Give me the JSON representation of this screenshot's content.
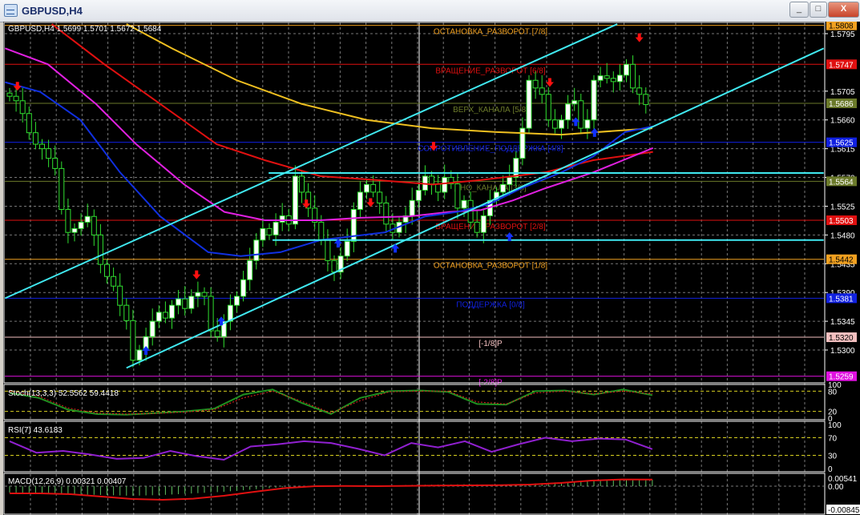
{
  "window": {
    "title": "GBPUSD,H4",
    "minimize_label": "_",
    "restore_label": "□",
    "close_label": "X"
  },
  "main": {
    "header": "GBPUSD,H4  1.5699 1.5701 1.5672 1.5684",
    "price_ticks": [
      "1.5795",
      "1.5705",
      "1.5660",
      "1.5615",
      "1.5570",
      "1.5525",
      "1.5480",
      "1.5435",
      "1.5390",
      "1.5345",
      "1.5300"
    ],
    "levels": [
      {
        "price": 1.5808,
        "label": "ОСТАНОВКА_РАЗВОРОТ [7/8]",
        "tag": "1.5808",
        "color": "#f0a020",
        "tagtext": "#000000"
      },
      {
        "price": 1.5747,
        "label": "ВРАЩЕНИЕ_РАЗВОРОТ [6/8]",
        "tag": "1.5747",
        "color": "#e01010",
        "tagtext": "#ffffff"
      },
      {
        "price": 1.5686,
        "label": "ВЕРХ_КАНАЛА [5/8]",
        "tag": "1.5686",
        "color": "#6b7a2a",
        "tagtext": "#ffffff"
      },
      {
        "price": 1.5625,
        "label": "СОПРОТИВЛЕНИЕ_ПОДДЕРЖКА [4/8]",
        "tag": "1.5625",
        "color": "#1020e0",
        "tagtext": "#ffffff"
      },
      {
        "price": 1.5564,
        "label": "ДНО_КАНАЛА [3/8]",
        "tag": "1.5564",
        "color": "#6b7a2a",
        "tagtext": "#ffffff"
      },
      {
        "price": 1.5503,
        "label": "ВРАЩЕНИЕ_РАЗВОРОТ [2/8]",
        "tag": "1.5503",
        "color": "#e01010",
        "tagtext": "#ffffff"
      },
      {
        "price": 1.5442,
        "label": "ОСТАНОВКА_РАЗВОРОТ [1/8]",
        "tag": "1.5442",
        "color": "#f0a020",
        "tagtext": "#000000"
      },
      {
        "price": 1.5381,
        "label": "ПОДДЕРЖКА [0/8]",
        "tag": "1.5381",
        "color": "#1020e0",
        "tagtext": "#ffffff"
      },
      {
        "price": 1.532,
        "label": "[-1/8]P",
        "tag": "1.5320",
        "color": "#f4c0c0",
        "tagtext": "#000000"
      },
      {
        "price": 1.5259,
        "label": "[-2/8]P",
        "tag": "1.5259",
        "color": "#e010e0",
        "tagtext": "#ffffff"
      }
    ],
    "closes": [
      1.5697,
      1.569,
      1.567,
      1.564,
      1.5622,
      1.5615,
      1.56,
      1.5584,
      1.552,
      1.5484,
      1.549,
      1.55,
      1.5509,
      1.548,
      1.5434,
      1.5415,
      1.54,
      1.537,
      1.5346,
      1.5284,
      1.53,
      1.5321,
      1.5345,
      1.5359,
      1.535,
      1.537,
      1.538,
      1.5365,
      1.5384,
      1.539,
      1.5384,
      1.533,
      1.5321,
      1.5345,
      1.537,
      1.5384,
      1.541,
      1.544,
      1.5472,
      1.549,
      1.548,
      1.55,
      1.551,
      1.5497,
      1.5572,
      1.5547,
      1.5522,
      1.55,
      1.5472,
      1.544,
      1.5422,
      1.5447,
      1.547,
      1.552,
      1.5547,
      1.5559,
      1.5547,
      1.553,
      1.5497,
      1.5484,
      1.55,
      1.551,
      1.5534,
      1.555,
      1.5572,
      1.556,
      1.5547,
      1.557,
      1.556,
      1.5522,
      1.5534,
      1.55,
      1.5484,
      1.551,
      1.5534,
      1.5547,
      1.5559,
      1.557,
      1.56,
      1.5647,
      1.5722,
      1.571,
      1.57,
      1.566,
      1.5647,
      1.566,
      1.5685,
      1.569,
      1.5647,
      1.566,
      1.5722,
      1.5729,
      1.5725,
      1.572,
      1.573,
      1.5747,
      1.571,
      1.57,
      1.5684
    ],
    "moving_averages": [
      {
        "name": "yellow-ma",
        "color": "#f0c020",
        "points": [
          [
            18,
            1.581
          ],
          [
            25,
            1.5772
          ],
          [
            35,
            1.5722
          ],
          [
            45,
            1.5685
          ],
          [
            55,
            1.566
          ],
          [
            65,
            1.5647
          ],
          [
            75,
            1.5641
          ],
          [
            85,
            1.5637
          ],
          [
            99,
            1.5647
          ]
        ]
      },
      {
        "name": "red-ma",
        "color": "#e01010",
        "points": [
          [
            6.5,
            1.581
          ],
          [
            14.6,
            1.5747
          ],
          [
            23.2,
            1.5685
          ],
          [
            31.9,
            1.5622
          ],
          [
            39.3,
            1.5597
          ],
          [
            47.9,
            1.5572
          ],
          [
            56.5,
            1.5566
          ],
          [
            65.2,
            1.5559
          ],
          [
            72.6,
            1.5566
          ],
          [
            82.5,
            1.5578
          ],
          [
            89.9,
            1.5597
          ],
          [
            99.1,
            1.561
          ]
        ]
      },
      {
        "name": "magenta-ma",
        "color": "#e020e0",
        "points": [
          [
            -0.7,
            1.5772
          ],
          [
            5.9,
            1.5747
          ],
          [
            13.3,
            1.5685
          ],
          [
            19.5,
            1.5622
          ],
          [
            26.9,
            1.5559
          ],
          [
            33.1,
            1.5516
          ],
          [
            39.3,
            1.5503
          ],
          [
            47.9,
            1.5503
          ],
          [
            54.1,
            1.5507
          ],
          [
            61.5,
            1.5509
          ],
          [
            67.7,
            1.5516
          ],
          [
            72.6,
            1.5519
          ],
          [
            77.5,
            1.5534
          ],
          [
            82.5,
            1.5553
          ],
          [
            89.9,
            1.5578
          ],
          [
            99.1,
            1.5616
          ]
        ]
      },
      {
        "name": "blue-ma",
        "color": "#1030e0",
        "points": [
          [
            -0.7,
            1.5719
          ],
          [
            4.7,
            1.5704
          ],
          [
            10.9,
            1.566
          ],
          [
            17,
            1.5578
          ],
          [
            23.2,
            1.5509
          ],
          [
            30.6,
            1.5453
          ],
          [
            35.6,
            1.5447
          ],
          [
            41.7,
            1.5453
          ],
          [
            47.9,
            1.5472
          ],
          [
            57.8,
            1.5484
          ],
          [
            64,
            1.5509
          ],
          [
            68.9,
            1.5516
          ],
          [
            73.8,
            1.5528
          ],
          [
            78.8,
            1.5553
          ],
          [
            85,
            1.5578
          ],
          [
            89.9,
            1.5603
          ],
          [
            94.8,
            1.5641
          ],
          [
            99.1,
            1.565
          ]
        ]
      }
    ],
    "trendlines": [
      {
        "from": [
          -0.7,
          1.5381
        ],
        "to": [
          93.6,
          1.581
        ]
      },
      {
        "from": [
          18,
          1.5272
        ],
        "to": [
          125.4,
          1.5772
        ]
      },
      {
        "from": [
          39.9,
          1.5577
        ],
        "to": [
          125.4,
          1.5577
        ]
      },
      {
        "from": [
          40.5,
          1.5472
        ],
        "to": [
          125.4,
          1.5472
        ]
      }
    ],
    "sell_arrows": [
      [
        1.2,
        1.5712
      ],
      [
        28.8,
        1.5417
      ],
      [
        45.7,
        1.5528
      ],
      [
        55.6,
        1.553
      ],
      [
        65.3,
        1.5618
      ],
      [
        83.2,
        1.5718
      ],
      [
        97,
        1.5788
      ]
    ],
    "buy_arrows": [
      [
        21,
        1.53
      ],
      [
        32.6,
        1.5346
      ],
      [
        50.6,
        1.5468
      ],
      [
        59.4,
        1.546
      ],
      [
        77,
        1.5478
      ],
      [
        87.2,
        1.5658
      ],
      [
        90.1,
        1.5641
      ]
    ]
  },
  "stoch": {
    "header": "Stoch(13,3,3) 52.5562 59.4418",
    "ticks": [
      "100",
      "80",
      "20",
      "0"
    ],
    "main": [
      75,
      60,
      25,
      12,
      10,
      15,
      20,
      28,
      70,
      85,
      45,
      12,
      60,
      80,
      82,
      78,
      42,
      40,
      80,
      82,
      70,
      85,
      68
    ],
    "signal": [
      80,
      65,
      30,
      15,
      12,
      14,
      18,
      25,
      60,
      80,
      50,
      15,
      52,
      78,
      80,
      80,
      48,
      42,
      75,
      80,
      72,
      80,
      72
    ]
  },
  "rsi": {
    "header": "RSI(7) 43.6183",
    "ticks": [
      "100",
      "70",
      "30",
      "0"
    ],
    "values": [
      62,
      36,
      40,
      32,
      22,
      24,
      40,
      28,
      20,
      50,
      55,
      62,
      58,
      45,
      30,
      58,
      48,
      62,
      38,
      55,
      70,
      62,
      68,
      66,
      44
    ]
  },
  "macd": {
    "header": "MACD(12,26,9) 0.00321 0.00407",
    "ticks": [
      "0.00541",
      "0.00",
      "-0.00845"
    ],
    "hist": [
      -0.004,
      -0.0045,
      -0.005,
      -0.0055,
      -0.006,
      -0.0055,
      -0.0045,
      -0.0035,
      -0.002,
      -0.0005,
      0.0005,
      0.0002,
      -0.0002,
      0.0008,
      0.001,
      0.0012,
      0.0008,
      0.0015,
      0.0025,
      0.0035,
      0.0045,
      0.004
    ],
    "signal": [
      -0.0045,
      -0.0045,
      -0.005,
      -0.0065,
      -0.008,
      -0.0085,
      -0.0078,
      -0.006,
      -0.0035,
      -0.0012,
      0.0,
      0.0001,
      0.0,
      0.0002,
      0.0004,
      0.0005,
      0.0006,
      0.001,
      0.002,
      0.0035,
      0.0042,
      0.0041
    ]
  },
  "colors": {
    "bg": "#000000",
    "bull": "#ffffff",
    "wick": "#30e030",
    "grid": "#8a8a8a",
    "cyan": "#40e8f0"
  }
}
